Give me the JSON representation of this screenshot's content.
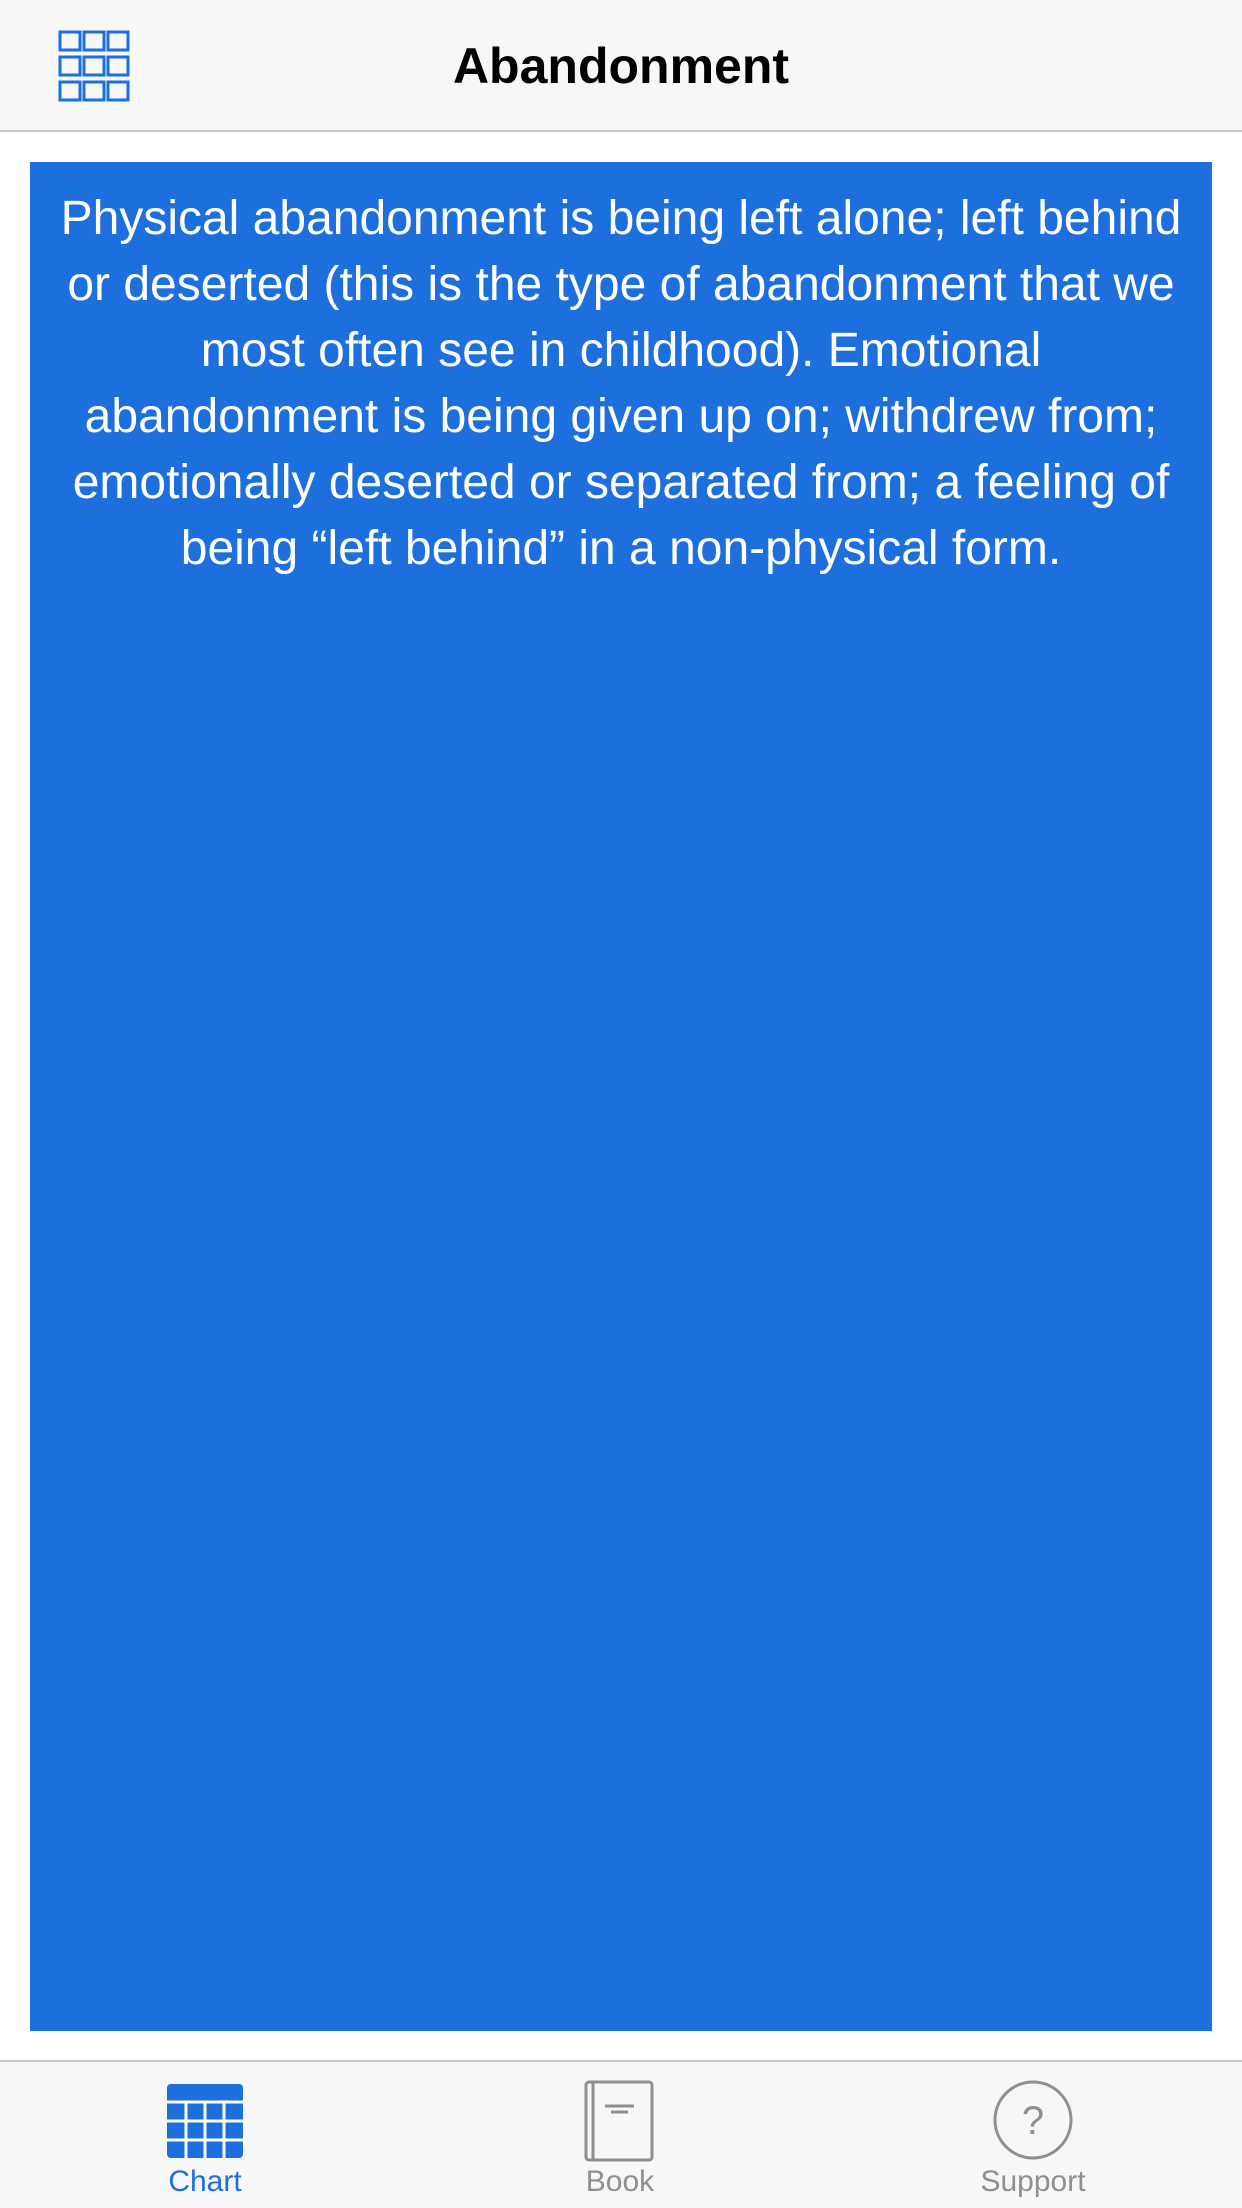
{
  "navbar": {
    "title": "Abandonment",
    "menu_icon": "grid-icon"
  },
  "card": {
    "text": "Physical abandonment is being left alone; left behind or deserted (this is the type of abandonment that we most often see in childhood). Emotional abandonment is being given up on; withdrew from; emotionally deserted or separated from; a feeling of being “left behind” in a non-physical form.",
    "background_color": "#1e6fde",
    "text_color": "#ffffff"
  },
  "tabbar": {
    "tabs": [
      {
        "label": "Chart",
        "icon": "chart-grid-icon",
        "active": true
      },
      {
        "label": "Book",
        "icon": "book-icon",
        "active": false
      },
      {
        "label": "Support",
        "icon": "question-circle-icon",
        "active": false
      }
    ]
  },
  "colors": {
    "accent": "#1e6fde",
    "inactive": "#8e8e93",
    "bar_background": "#f7f7f7"
  }
}
